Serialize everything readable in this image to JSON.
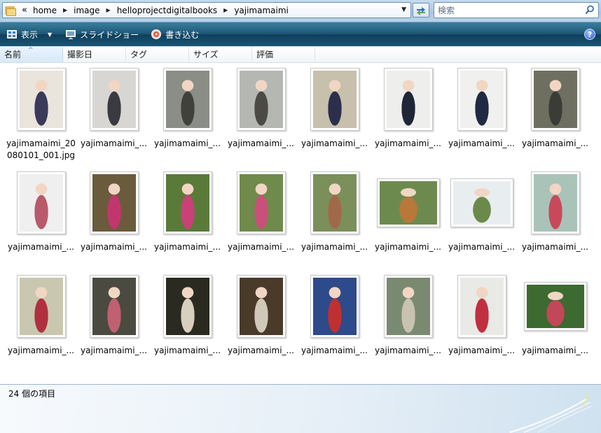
{
  "address": {
    "overflow": "«",
    "crumbs": [
      "home",
      "image",
      "helloprojectdigitalbooks",
      "yajimamaimi"
    ]
  },
  "search": {
    "placeholder": "検索"
  },
  "toolbar": {
    "view_label": "表示",
    "slideshow_label": "スライドショー",
    "burn_label": "書き込む",
    "help_label": "?"
  },
  "columns": [
    "名前",
    "撮影日",
    "タグ",
    "サイズ",
    "評価"
  ],
  "files": [
    {
      "name": "yajimamaimi_20080101_001.jpg",
      "orientation": "portrait",
      "palette": [
        "#e9e4dc",
        "#3b3a5a"
      ]
    },
    {
      "name": "yajimamaimi_...",
      "orientation": "portrait",
      "palette": [
        "#d8d6d2",
        "#3a3b40"
      ]
    },
    {
      "name": "yajimamaimi_...",
      "orientation": "portrait",
      "palette": [
        "#8a8e86",
        "#41413c"
      ]
    },
    {
      "name": "yajimamaimi_...",
      "orientation": "portrait",
      "palette": [
        "#b5b7b3",
        "#4b4a44"
      ]
    },
    {
      "name": "yajimamaimi_...",
      "orientation": "portrait",
      "palette": [
        "#c6c0ac",
        "#2b2f4c"
      ]
    },
    {
      "name": "yajimamaimi_...",
      "orientation": "portrait",
      "palette": [
        "#eeeeec",
        "#1f2638"
      ]
    },
    {
      "name": "yajimamaimi_...",
      "orientation": "portrait",
      "palette": [
        "#f0f0ee",
        "#202a44"
      ]
    },
    {
      "name": "yajimamaimi_...",
      "orientation": "portrait",
      "palette": [
        "#6e6f60",
        "#3a3d35"
      ]
    },
    {
      "name": "yajimamaimi_...",
      "orientation": "portrait",
      "palette": [
        "#efefef",
        "#b85a6a"
      ]
    },
    {
      "name": "yajimamaimi_...",
      "orientation": "portrait",
      "palette": [
        "#6a5b3c",
        "#c2366e"
      ]
    },
    {
      "name": "yajimamaimi_...",
      "orientation": "portrait",
      "palette": [
        "#5a7a3a",
        "#c84278"
      ]
    },
    {
      "name": "yajimamaimi_...",
      "orientation": "portrait",
      "palette": [
        "#6f8a4a",
        "#c8507a"
      ]
    },
    {
      "name": "yajimamaimi_...",
      "orientation": "portrait",
      "palette": [
        "#7a8f5a",
        "#a06a4a"
      ]
    },
    {
      "name": "yajimamaimi_...",
      "orientation": "landscape",
      "palette": [
        "#6d8a4e",
        "#b8783a"
      ]
    },
    {
      "name": "yajimamaimi_...",
      "orientation": "landscape",
      "palette": [
        "#e8eef0",
        "#6b8a4a"
      ]
    },
    {
      "name": "yajimamaimi_...",
      "orientation": "portrait",
      "palette": [
        "#a9c3b8",
        "#c84a5a"
      ]
    },
    {
      "name": "yajimamaimi_...",
      "orientation": "portrait",
      "palette": [
        "#c9c7b0",
        "#b03040"
      ]
    },
    {
      "name": "yajimamaimi_...",
      "orientation": "portrait",
      "palette": [
        "#4a4a40",
        "#c06070"
      ]
    },
    {
      "name": "yajimamaimi_...",
      "orientation": "portrait",
      "palette": [
        "#2a2a20",
        "#d8cfc0"
      ]
    },
    {
      "name": "yajimamaimi_...",
      "orientation": "portrait",
      "palette": [
        "#4a3a2a",
        "#d0c8b8"
      ]
    },
    {
      "name": "yajimamaimi_...",
      "orientation": "portrait",
      "palette": [
        "#2d4a8a",
        "#c03030"
      ]
    },
    {
      "name": "yajimamaimi_...",
      "orientation": "portrait",
      "palette": [
        "#7a8a70",
        "#c9c2b0"
      ]
    },
    {
      "name": "yajimamaimi_...",
      "orientation": "portrait",
      "palette": [
        "#e9eae6",
        "#c03040"
      ]
    },
    {
      "name": "yajimamaimi_...",
      "orientation": "landscape",
      "palette": [
        "#3c6a30",
        "#c04858"
      ]
    }
  ],
  "status": {
    "item_count": "24 個の項目"
  }
}
